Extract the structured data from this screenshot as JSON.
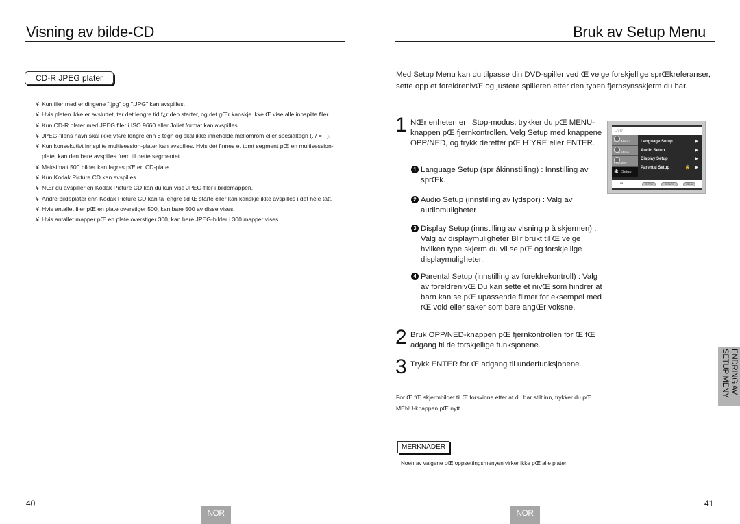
{
  "left_page": {
    "title": "Visning av bilde-CD",
    "section_tag": "CD-R JPEG plater",
    "bullet_marker": "¥",
    "bullets": [
      "Kun filer med endingene \".jpg\" og \".JPG\" kan avspilles.",
      "Hvis platen ikke er avsluttet, tar det lengre tid f¿r den starter, og det gŒr kanskje ikke Œ vise alle innspilte filer.",
      "Kun CD-R plater med JPEG filer i ISO 9660 eller Joliet format kan avspilles.",
      "JPEG-filens navn skal ikke v¾re lengre enn 8 tegn og skal ikke inneholde mellomrom eller spesialtegn (. / = +).",
      "Kun konsekutivt innspilte multisession-plater kan avspilles. Hvis det finnes et tomt segment pŒ en multisession-plate, kan den bare avspilles frem til dette segmentet.",
      "Maksimalt 500 bilder kan lagres pŒ en CD-plate.",
      "Kun Kodak Picture CD kan avspilles.",
      "NŒr du avspiller en Kodak Picture CD kan du kun vise JPEG-filer i bildemappen.",
      "Andre bildeplater enn Kodak Picture CD kan ta lengre tid Œ starte eller kan kanskje ikke avspilles i det hele tatt.",
      "Hvis antallet filer pŒ en plate overstiger 500, kan bare 500 av disse vises.",
      "Hvis antallet mapper pŒ en plate overstiger 300, kan bare JPEG-bilder i 300 mapper vises."
    ],
    "page_number": "40",
    "language_badge": "NOR"
  },
  "right_page": {
    "title": "Bruk av Setup Menu",
    "intro": "Med Setup Menu kan du tilpasse din DVD-spiller ved Œ velge forskjellige sprŒkreferanser, sette opp et foreldrenivŒ og justere spilleren etter den typen fjernsynsskjerm du har.",
    "steps": [
      {
        "number": "1",
        "text": "NŒr enheten er i Stop-modus, trykker du pŒ MENU-knappen pŒ fjernkontrollen. Velg Setup  med knappene OPP/NED, og trykk deretter pŒ H˜YRE eller ENTER."
      },
      {
        "number": "2",
        "text": "Bruk OPP/NED-knappen pŒ fjernkontrollen for Œ fŒ adgang til de forskjellige funksjonene."
      },
      {
        "number": "3",
        "text": "Trykk ENTER for Œ adgang til underfunksjonene."
      }
    ],
    "sub_items": [
      {
        "marker": "1",
        "text": "Language Setup (spr  åkinnstilling) : Innstilling av sprŒk."
      },
      {
        "marker": "2",
        "text": "Audio Setup (innstilling av lydspor) : Valg av audiomuligheter"
      },
      {
        "marker": "3",
        "text": "Display Setup (innstilling av visning p    å skjermen) :  Valg av displaymuligheter Blir brukt til Œ velge hvilken type skjerm du vil se pŒ og forskjellige displaymuligheter."
      },
      {
        "marker": "4",
        "text": "Parental Setup (innstilling av foreldrekontroll) :   Valg av foreldrenivŒ Du kan sette et nivŒ som hindrer at barn kan se pŒ upassende filmer for eksempel med rŒ vold eller saker som bare angŒr voksne."
      }
    ],
    "after_note": "For Œ fŒ skjermbildet til Œ forsvinne etter at du har stilt inn, trykker du pŒ MENU-knappen pŒ nytt.",
    "notes_tag": "MERKNADER",
    "notes_text": "Noen av valgene pŒ oppsettingsmenyen virker ikke pŒ alle plater.",
    "side_tab": "ENDRING AV SETUP MENY",
    "page_number": "41",
    "language_badge": "NOR",
    "osd": {
      "header": "DVD",
      "side_items": [
        "Disc Menu",
        "Title Menu",
        "Function",
        "Setup"
      ],
      "menu_items": [
        "Language Setup",
        "Audio Setup",
        "Display Setup",
        "Parental Setup :"
      ],
      "arrow": "▶",
      "lock_icon": "🔓",
      "bottom_buttons": [
        "ENTER",
        "RETURN",
        "MENU"
      ]
    }
  }
}
